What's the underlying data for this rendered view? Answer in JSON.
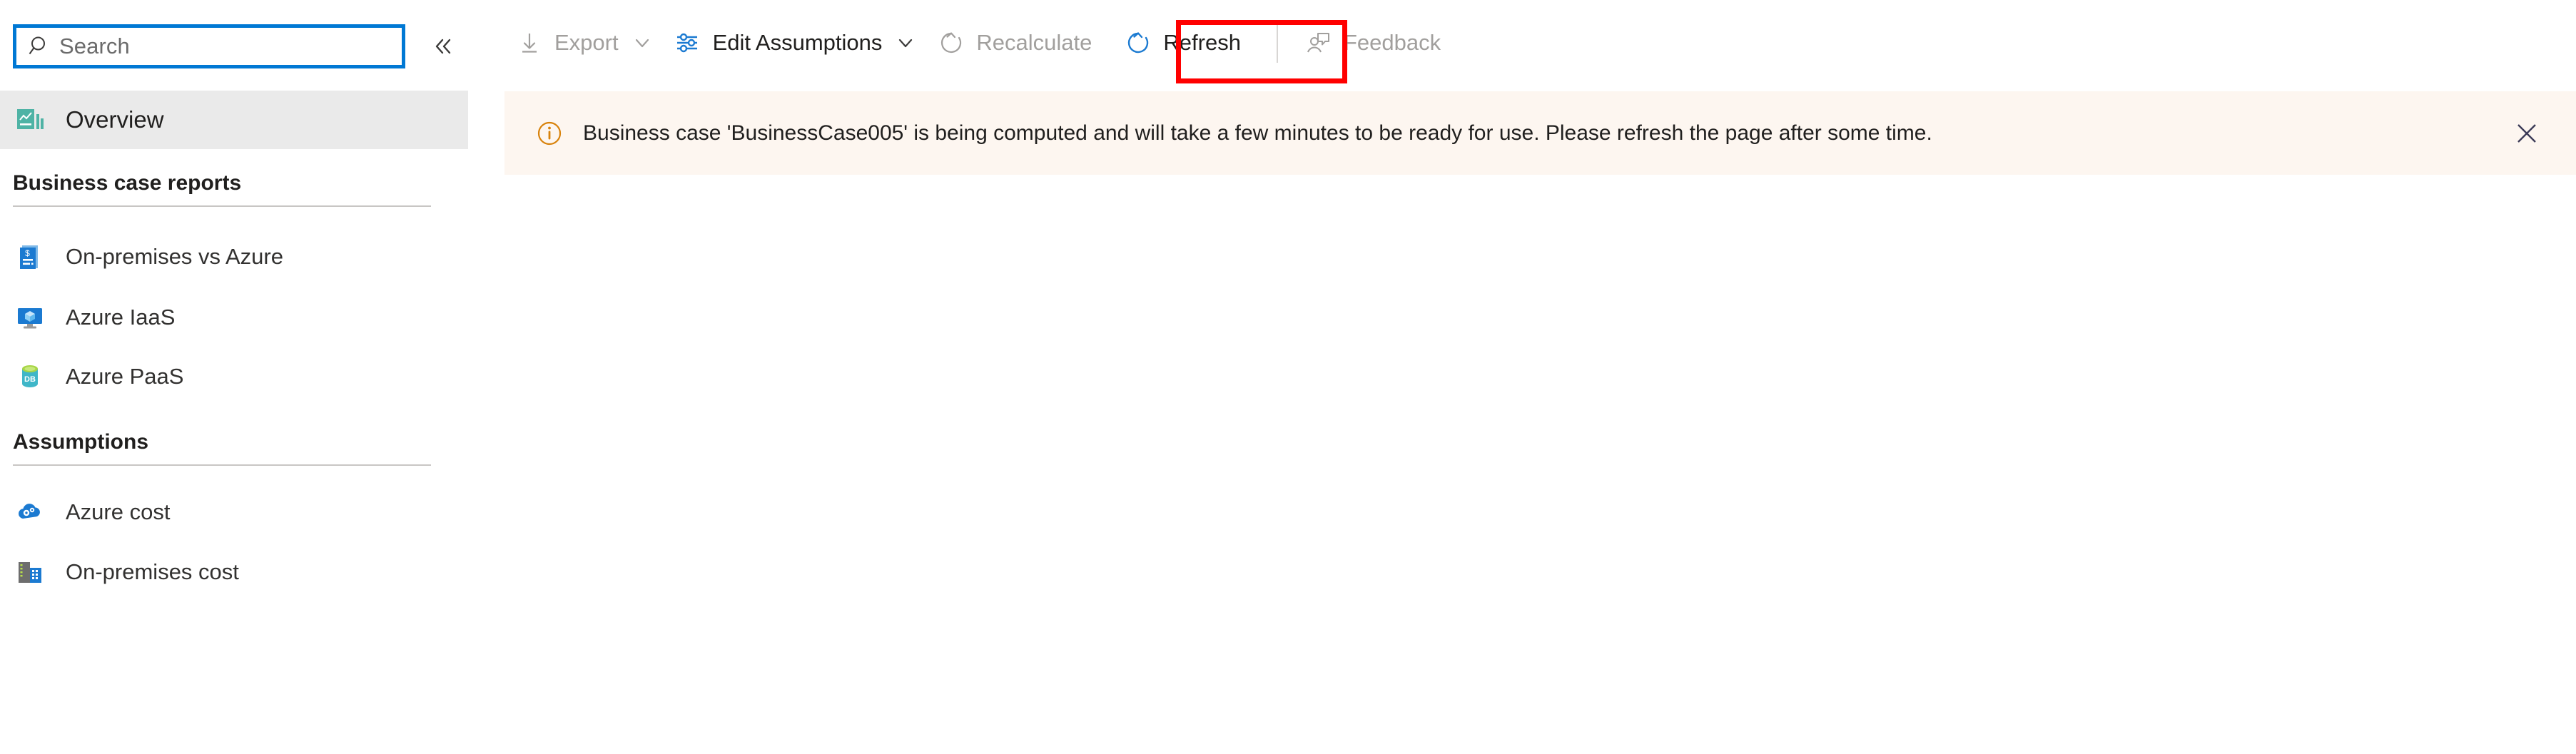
{
  "sidebar": {
    "search": {
      "placeholder": "Search",
      "icon": "search-icon"
    },
    "collapse": {
      "icon": "chevron-double-left-icon",
      "label": "«"
    },
    "active_item": {
      "label": "Overview",
      "icon": "overview-chart-icon"
    },
    "sections": [
      {
        "title": "Business case reports",
        "items": [
          {
            "label": "On-premises vs Azure",
            "icon": "invoice-document-icon"
          },
          {
            "label": "Azure IaaS",
            "icon": "virtual-machine-icon"
          },
          {
            "label": "Azure PaaS",
            "icon": "database-icon"
          }
        ]
      },
      {
        "title": "Assumptions",
        "items": [
          {
            "label": "Azure cost",
            "icon": "cloud-settings-icon"
          },
          {
            "label": "On-premises cost",
            "icon": "server-building-icon"
          }
        ]
      }
    ]
  },
  "toolbar": {
    "items": [
      {
        "label": "Export",
        "icon": "download-arrow-icon",
        "disabled": true,
        "has_chevron": true
      },
      {
        "label": "Edit Assumptions",
        "icon": "sliders-icon",
        "disabled": false,
        "has_chevron": true
      },
      {
        "label": "Recalculate",
        "icon": "refresh-circle-icon",
        "disabled": true,
        "has_chevron": false
      },
      {
        "label": "Refresh",
        "icon": "refresh-circle-icon",
        "disabled": false,
        "has_chevron": false
      },
      {
        "label": "Feedback",
        "icon": "person-feedback-icon",
        "disabled": true,
        "has_chevron": false
      }
    ]
  },
  "message_bar": {
    "icon": "info-circle-icon",
    "text": "Business case 'BusinessCase005' is being computed and will take a few minutes to be ready for use. Please refresh the page after some time.",
    "close_icon": "close-icon",
    "background_color": "#fdf6f0",
    "icon_color": "#d8820b"
  },
  "annotation": {
    "highlight_target": "Refresh",
    "color": "#ff0000"
  },
  "colors": {
    "accent_blue": "#0078d4",
    "sidebar_selected": "#eaeaea",
    "text_primary": "#201f1e",
    "text_disabled": "#a19f9d",
    "divider": "#c8c6c4"
  }
}
